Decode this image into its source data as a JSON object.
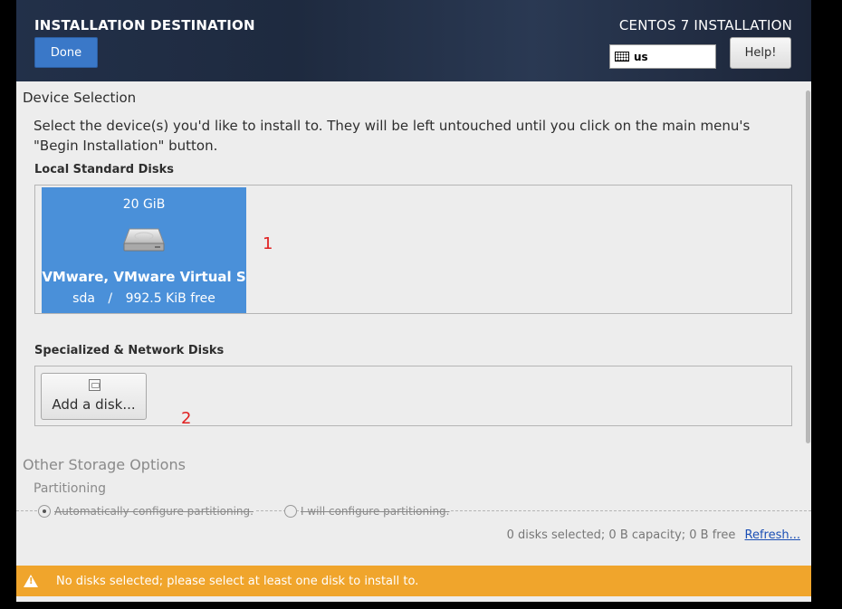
{
  "header": {
    "title": "INSTALLATION DESTINATION",
    "done_label": "Done",
    "product": "CENTOS 7 INSTALLATION",
    "keyboard_layout": "us",
    "help_label": "Help!"
  },
  "device_selection": {
    "title": "Device Selection",
    "description": "Select the device(s) you'd like to install to.  They will be left untouched until you click on the main menu's \"Begin Installation\" button."
  },
  "local_disks": {
    "title": "Local Standard Disks",
    "disks": [
      {
        "size": "20 GiB",
        "name": "VMware, VMware Virtual S",
        "device": "sda",
        "separator": "/",
        "free": "992.5 KiB free",
        "icon": "hard-disk-icon",
        "selected": true
      }
    ],
    "annotation": "1"
  },
  "network_disks": {
    "title": "Specialized & Network Disks",
    "add_disk_label": "Add a disk...",
    "annotation": "2"
  },
  "other_storage": {
    "title": "Other Storage Options",
    "partitioning_title": "Partitioning",
    "options": [
      {
        "label": "Automatically configure partitioning.",
        "selected": true
      },
      {
        "label": "I will configure partitioning.",
        "selected": false
      }
    ]
  },
  "summary": {
    "text": "0 disks selected; 0 B capacity; 0 B free",
    "refresh_label": "Refresh..."
  },
  "warning": {
    "icon": "warning-icon",
    "text": "No disks selected; please select at least one disk to install to."
  },
  "colors": {
    "header_bg": "#1e2a3f",
    "accent_blue": "#3a78c8",
    "disk_selected": "#4a90d9",
    "warning_bar": "#f0a52c",
    "annotation_red": "#e02020"
  }
}
